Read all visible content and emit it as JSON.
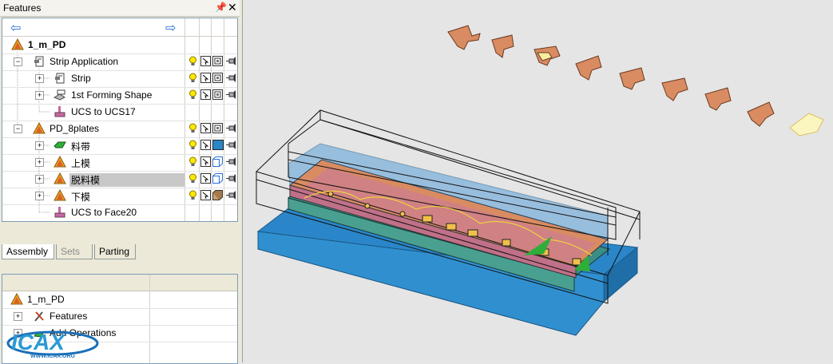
{
  "panel": {
    "title": "Features",
    "pin_glyph": "⌂",
    "close_glyph": "✕"
  },
  "nav": {
    "back_icon": "back-arrow-icon",
    "forward_icon": "forward-arrow-icon"
  },
  "tree": {
    "root": "1_m_PD",
    "items": [
      {
        "label": "Strip Application",
        "icon": "strip-app-icon"
      },
      {
        "label": "Strip",
        "icon": "strip-icon"
      },
      {
        "label": "1st Forming Shape",
        "icon": "forming-shape-icon"
      },
      {
        "label": "UCS to UCS17",
        "icon": "ucs-icon"
      },
      {
        "label": "PD_8plates",
        "icon": "plates-icon"
      },
      {
        "label": "料带",
        "icon": "strip-part-icon"
      },
      {
        "label": "上模",
        "icon": "upper-die-icon"
      },
      {
        "label": "脱料模",
        "icon": "stripper-die-icon"
      },
      {
        "label": "下模",
        "icon": "lower-die-icon"
      },
      {
        "label": "UCS to Face20",
        "icon": "ucs-icon"
      }
    ]
  },
  "tabs": [
    {
      "label": "Assembly",
      "state": "active"
    },
    {
      "label": "Sets",
      "state": "disabled"
    },
    {
      "label": "Parting",
      "state": "normal"
    }
  ],
  "lower_tree": {
    "root": "1_m_PD",
    "items": [
      {
        "label": "Features"
      },
      {
        "label": "Add Operations"
      }
    ]
  },
  "logo": {
    "text": "ICAX",
    "url_text": "WWW.ICAX.ORG"
  },
  "colors": {
    "accent": "#2a6fd6",
    "die_blue": "#2a86c8",
    "strip_copper": "#d98b62",
    "highlight_yellow": "#f5f0a0"
  }
}
